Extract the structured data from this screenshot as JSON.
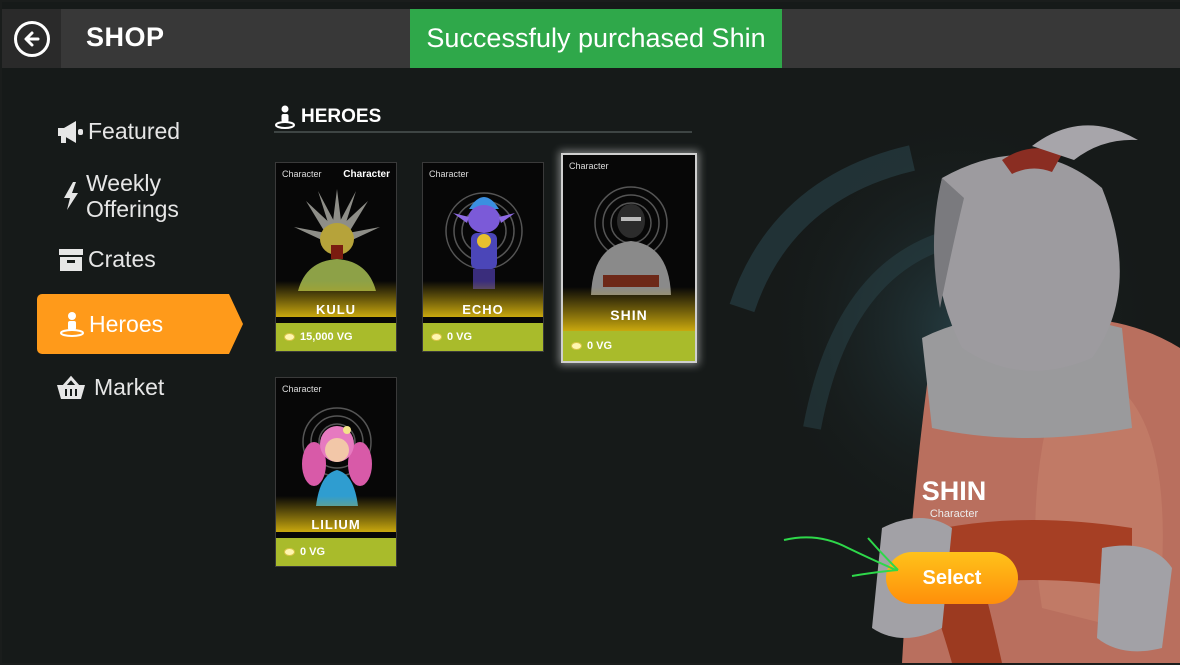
{
  "header": {
    "title": "SHOP",
    "toast": "Successfuly purchased Shin",
    "back_icon": "arrow-left-icon"
  },
  "sidebar": {
    "items": [
      {
        "label": "Featured",
        "icon": "megaphone-icon",
        "active": false
      },
      {
        "label": "Weekly\nOfferings",
        "icon": "lightning-icon",
        "active": false
      },
      {
        "label": "Crates",
        "icon": "crate-icon",
        "active": false
      },
      {
        "label": "Heroes",
        "icon": "hero-icon",
        "active": true
      },
      {
        "label": "Market",
        "icon": "basket-icon",
        "active": false
      }
    ]
  },
  "section": {
    "title": "HEROES"
  },
  "heroes": [
    {
      "tag": "Character",
      "tag2": "Character",
      "name": "KULU",
      "price": "15,000 VG"
    },
    {
      "tag": "Character",
      "name": "ECHO",
      "price": "0 VG"
    },
    {
      "tag": "Character",
      "name": "SHIN",
      "price": "0 VG",
      "selected": true
    },
    {
      "tag": "Character",
      "name": "LILIUM",
      "price": "0 VG"
    }
  ],
  "preview": {
    "name": "SHIN",
    "subtitle": "Character",
    "select_label": "Select"
  },
  "colors": {
    "accent": "#ff9a1a",
    "toast": "#2fa84a",
    "price_bar": "#a9bb2b"
  }
}
